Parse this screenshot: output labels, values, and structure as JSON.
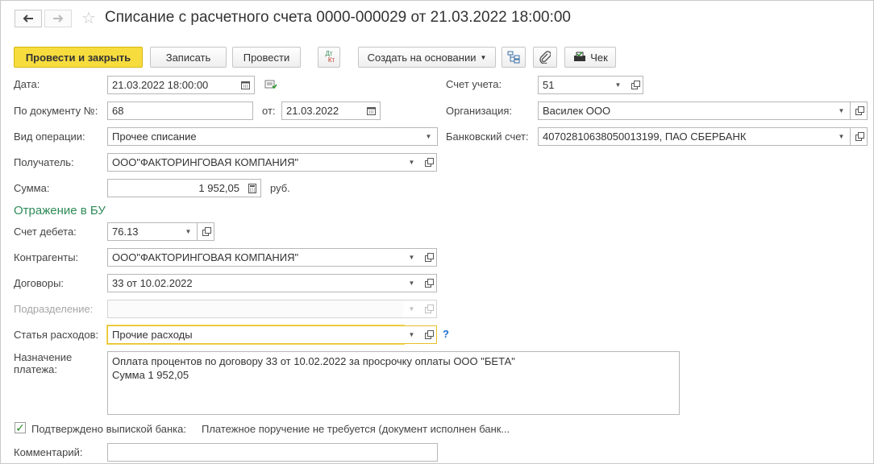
{
  "header": {
    "title": "Списание с расчетного счета 0000-000029 от 21.03.2022 18:00:00",
    "back_icon": "arrow-left-icon",
    "forward_icon": "arrow-right-icon",
    "favorite_icon": "star-icon"
  },
  "toolbar": {
    "post_and_close": "Провести и закрыть",
    "save": "Записать",
    "post": "Провести",
    "dt_kt_top": "Дт",
    "dt_kt_bottom": "Кт",
    "create_based_on": "Создать на основании",
    "check": "Чек",
    "accent_color": "#f7dc3e"
  },
  "form": {
    "date": {
      "label": "Дата:",
      "value": "21.03.2022 18:00:00"
    },
    "doc_number": {
      "label": "По документу №:",
      "value": "68"
    },
    "doc_date": {
      "label": "от:",
      "value": "21.03.2022"
    },
    "operation": {
      "label": "Вид операции:",
      "value": "Прочее списание"
    },
    "recipient": {
      "label": "Получатель:",
      "value": "ООО\"ФАКТОРИНГОВАЯ КОМПАНИЯ\""
    },
    "amount": {
      "label": "Сумма:",
      "value": "1 952,05",
      "currency": "руб."
    },
    "account": {
      "label": "Счет учета:",
      "value": "51"
    },
    "organization": {
      "label": "Организация:",
      "value": "Василек ООО"
    },
    "bank_account": {
      "label": "Банковский счет:",
      "value": "40702810638050013199, ПАО СБЕРБАНК"
    }
  },
  "bu_section": {
    "title": "Отражение в БУ",
    "debit_account": {
      "label": "Счет дебета:",
      "value": "76.13"
    },
    "counterparties": {
      "label": "Контрагенты:",
      "value": "ООО\"ФАКТОРИНГОВАЯ КОМПАНИЯ\""
    },
    "contracts": {
      "label": "Договоры:",
      "value": "33 от 10.02.2022"
    },
    "department": {
      "label": "Подразделение:",
      "value": ""
    },
    "expense_item": {
      "label": "Статья расходов:",
      "value": "Прочие расходы"
    },
    "help": "?"
  },
  "payment_purpose": {
    "label_line1": "Назначение",
    "label_line2": "платежа:",
    "line1": "Оплата процентов по договору 33 от 10.02.2022 за просрочку оплаты ООО \"БЕТА\"",
    "line2": "Сумма 1 952,05"
  },
  "footer": {
    "confirmed_label": "Подтверждено выпиской банка:",
    "confirmed_checked": true,
    "payment_order_status": "Платежное поручение не требуется (документ исполнен банк...",
    "comment_label": "Комментарий:",
    "comment_value": ""
  }
}
